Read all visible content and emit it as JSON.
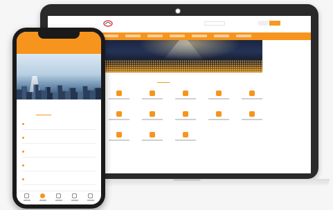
{
  "colors": {
    "accent": "#f7941d",
    "laptop_bezel": "#2a2a2b",
    "phone_body": "#1a1a1a"
  },
  "laptop": {
    "header": {
      "logo_icon": "brand-logo-icon",
      "site_name": "",
      "search_placeholder": "",
      "link_1": "",
      "link_2": "",
      "login_label": "",
      "register_label": ""
    },
    "nav_tabs_count_visible": 7,
    "banner_icon": "concert-crowd-image",
    "section_tabs": {
      "active": "",
      "inactive": ""
    },
    "tile_icon": "category-icon",
    "tile_rows": 3
  },
  "phone": {
    "title": "",
    "banner_icon": "city-skyline-image",
    "tabs": {
      "active": "",
      "inactive": ""
    },
    "list_items": [
      "",
      "",
      "",
      "",
      ""
    ],
    "bottom_nav": [
      "home-icon",
      "service-icon",
      "message-icon",
      "cart-icon",
      "profile-icon"
    ],
    "bottom_nav_active_index": 1
  }
}
